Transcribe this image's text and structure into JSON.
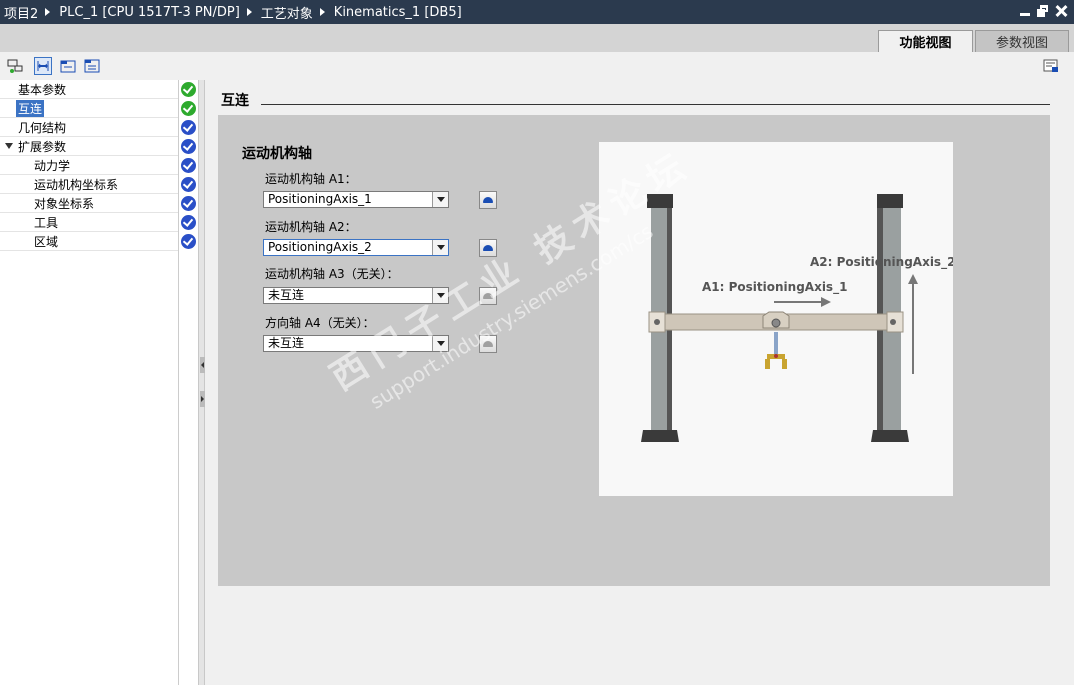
{
  "breadcrumb": [
    "项目2",
    "PLC_1 [CPU 1517T-3 PN/DP]",
    "工艺对象",
    "Kinematics_1 [DB5]"
  ],
  "view_tabs": {
    "function_view": "功能视图",
    "parameter_view": "参数视图"
  },
  "toolbar_icons": [
    "monitor-icon",
    "expand-view-icon",
    "folder-view-icon",
    "collapsed-view-icon"
  ],
  "nav_tree": {
    "items": [
      {
        "label": "基本参数",
        "status": "ok"
      },
      {
        "label": "互连",
        "status": "ok",
        "selected": true
      },
      {
        "label": "几何结构",
        "status": "info"
      },
      {
        "label": "扩展参数",
        "status": "info",
        "expanded": true
      },
      {
        "label": "动力学",
        "status": "info"
      },
      {
        "label": "运动机构坐标系",
        "status": "info"
      },
      {
        "label": "对象坐标系",
        "status": "info"
      },
      {
        "label": "工具",
        "status": "info"
      },
      {
        "label": "区域",
        "status": "info"
      }
    ]
  },
  "section": {
    "title": "互连"
  },
  "group": {
    "title": "运动机构轴",
    "fields": [
      {
        "label": "运动机构轴 A1：",
        "value": "PositioningAxis_1",
        "button_enabled": true
      },
      {
        "label": "运动机构轴 A2：",
        "value": "PositioningAxis_2",
        "button_enabled": true
      },
      {
        "label": "运动机构轴 A3（无关）：",
        "value": "未互连",
        "button_enabled": false
      },
      {
        "label": "方向轴 A4（无关）：",
        "value": "未互连",
        "button_enabled": false
      }
    ]
  },
  "figure": {
    "a1_label": "A1: PositioningAxis_1",
    "a2_label": "A2: PositioningAxis_2"
  },
  "watermark": {
    "line1": "西门子工业 技术论坛",
    "line2": "support.industry.siemens.com/cs"
  },
  "colors": {
    "titlebar": "#2b3a4e",
    "ok": "#2eaa2e",
    "info": "#2a4fc7",
    "selection": "#3b73c4",
    "panel": "#c8c8c8"
  }
}
